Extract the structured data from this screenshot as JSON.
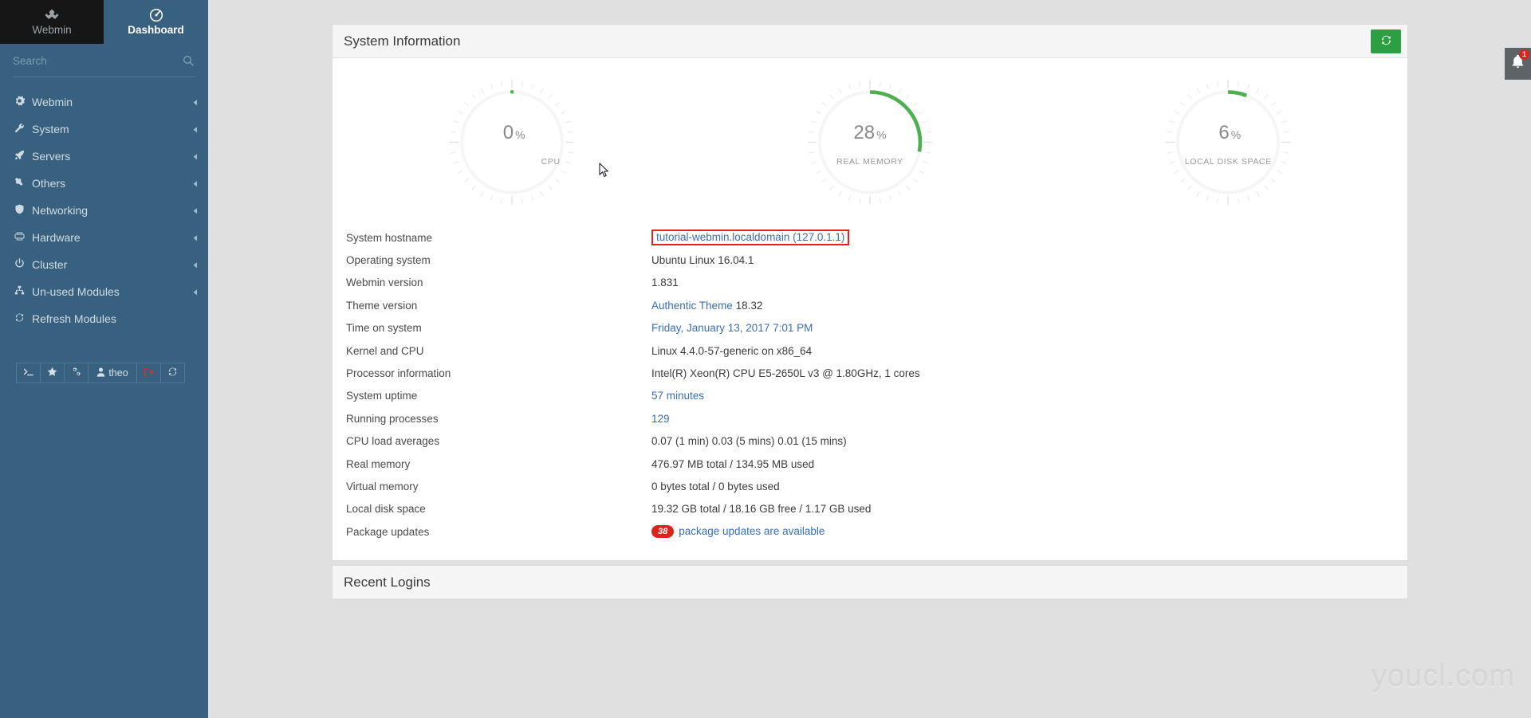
{
  "brand": {
    "left_label": "Webmin",
    "left_icon": "webmin-logo-icon",
    "right_label": "Dashboard",
    "right_icon": "dashboard-gauge-icon"
  },
  "search": {
    "placeholder": "Search",
    "value": "",
    "icon": "search-icon"
  },
  "sidebar": {
    "items": [
      {
        "label": "Webmin",
        "icon": "gear-icon",
        "chevron": "◂"
      },
      {
        "label": "System",
        "icon": "wrench-icon",
        "chevron": "◂"
      },
      {
        "label": "Servers",
        "icon": "rocket-icon",
        "chevron": "◂"
      },
      {
        "label": "Others",
        "icon": "hammer-icon",
        "chevron": "◂"
      },
      {
        "label": "Networking",
        "icon": "shield-icon",
        "chevron": "◂"
      },
      {
        "label": "Hardware",
        "icon": "printer-icon",
        "chevron": "◂"
      },
      {
        "label": "Cluster",
        "icon": "power-icon",
        "chevron": "◂"
      },
      {
        "label": "Un-used Modules",
        "icon": "sitemap-icon",
        "chevron": "◂"
      },
      {
        "label": "Refresh Modules",
        "icon": "refresh-icon",
        "chevron": ""
      }
    ],
    "quickbar": [
      {
        "name": "terminal-button",
        "icon": "terminal-icon",
        "label": ""
      },
      {
        "name": "favorites-button",
        "icon": "star-icon",
        "label": ""
      },
      {
        "name": "theme-config-button",
        "icon": "gears-icon",
        "label": ""
      },
      {
        "name": "user-button",
        "icon": "user-icon",
        "label": "theo"
      },
      {
        "name": "logout-button",
        "icon": "logout-icon",
        "label": ""
      },
      {
        "name": "refresh-button",
        "icon": "refresh-icon",
        "label": ""
      }
    ]
  },
  "notification": {
    "icon": "bell-icon",
    "count": "1"
  },
  "panels": {
    "system_information": {
      "title": "System Information",
      "refresh_icon": "refresh-icon"
    },
    "recent_logins": {
      "title": "Recent Logins"
    }
  },
  "gauges": [
    {
      "value": "0",
      "unit": "%",
      "label": "CPU",
      "percent": 0,
      "color": "#4caf50"
    },
    {
      "value": "28",
      "unit": "%",
      "label": "REAL MEMORY",
      "percent": 28,
      "color": "#4caf50"
    },
    {
      "value": "6",
      "unit": "%",
      "label": "LOCAL DISK SPACE",
      "percent": 6,
      "color": "#4caf50"
    }
  ],
  "system_info": [
    {
      "label": "System hostname",
      "value": "tutorial-webmin.localdomain (127.0.1.1)",
      "style": "link-boxed"
    },
    {
      "label": "Operating system",
      "value": "Ubuntu Linux 16.04.1",
      "style": "plain"
    },
    {
      "label": "Webmin version",
      "value": "1.831",
      "style": "plain"
    },
    {
      "label": "Theme version",
      "value": "Authentic Theme",
      "value2": " 18.32",
      "style": "link-plus"
    },
    {
      "label": "Time on system",
      "value": "Friday, January 13, 2017 7:01 PM",
      "style": "link"
    },
    {
      "label": "Kernel and CPU",
      "value": "Linux 4.4.0-57-generic on x86_64",
      "style": "plain"
    },
    {
      "label": "Processor information",
      "value": "Intel(R) Xeon(R) CPU E5-2650L v3 @ 1.80GHz, 1 cores",
      "style": "plain"
    },
    {
      "label": "System uptime",
      "value": "57 minutes",
      "style": "link"
    },
    {
      "label": "Running processes",
      "value": "129",
      "style": "link"
    },
    {
      "label": "CPU load averages",
      "value": "0.07 (1 min) 0.03 (5 mins) 0.01 (15 mins)",
      "style": "plain"
    },
    {
      "label": "Real memory",
      "value": "476.97 MB total / 134.95 MB used",
      "style": "plain"
    },
    {
      "label": "Virtual memory",
      "value": "0 bytes total / 0 bytes used",
      "style": "plain"
    },
    {
      "label": "Local disk space",
      "value": "19.32 GB total / 18.16 GB free / 1.17 GB used",
      "style": "plain"
    },
    {
      "label": "Package updates",
      "value": "package updates are available",
      "badge": "38",
      "style": "badge-link"
    }
  ],
  "watermark": "youcl.com",
  "colors": {
    "sidebar": "#38617f",
    "brand_dark": "#161616",
    "accent_green": "#2e9e42",
    "gauge_green": "#4caf50",
    "link_blue": "#3a6eb5",
    "alert_red": "#d9251d"
  }
}
